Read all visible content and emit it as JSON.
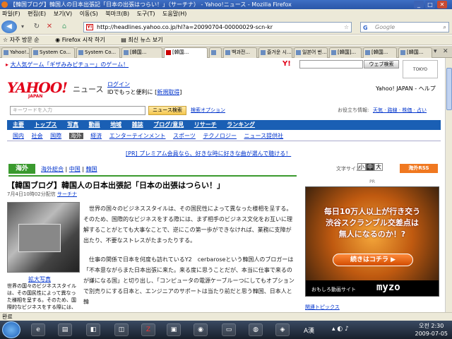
{
  "window": {
    "title": "【韓国ブログ】韓国人の日本出張記「日本の出張はつらい！」（サーチナ） - Yahoo!ニュース - Mozilla Firefox"
  },
  "menu": [
    "파일(F)",
    "편집(E)",
    "보기(V)",
    "이동(S)",
    "북마크(B)",
    "도구(T)",
    "도움말(H)"
  ],
  "nav": {
    "url": "http://headlines.yahoo.co.jp/hl?a=20090704-00000029-scn-kr",
    "search_placeholder": "Google"
  },
  "bookmarks": [
    "자주 방문 순",
    "Firefox 시작 하기",
    "최신 뉴스 보기"
  ],
  "tabs": [
    "Yahoo!...",
    "System Co...",
    "System Co...",
    "[韓国...",
    "[韓国...",
    "[韓国...",
    "[韓国...",
    "[韓国...",
    "백과전...",
    "즐거운 시...",
    "일본어 번...",
    "[韓国]...",
    "[韓国...",
    "[韓国..."
  ],
  "page": {
    "banner_text": "大人気ゲーム「ギザみみピチュー」のゲーム！",
    "logo": "YAHOO!",
    "logo_sub": "JAPAN",
    "news_label": "ニュース",
    "login_text": "ログイン",
    "login_sub": "IDでもっと便利に",
    "register": "新規取得",
    "top_links": "Yahoo! JAPAN - ヘルプ",
    "search_placeholder": "キーワードを入力",
    "search_button": "ニュース検索",
    "search_option": "検索オプション",
    "sites_label": "お役立ち情報:",
    "sites": "天気 · 路線 · 株価 · 占い",
    "global_nav": [
      "トップス",
      "写真",
      "動画",
      "地域",
      "雑誌",
      "ブログ/意見",
      "リサーチ",
      "ランキング"
    ],
    "global_nav_top": "主要",
    "sub_nav": [
      "国際",
      "経済",
      "エンターテインメント",
      "スポーツ",
      "テクノロジー",
      "ニュース提供社"
    ],
    "sub_nav_first": [
      "国内",
      "社会"
    ],
    "sub_nav_active": "海外",
    "promo_text": "[PR] プレミアム会員なら、好きな時に好きな曲が選んで聴ける！",
    "category_label": "海外",
    "breadcrumbs": [
      "海外総合",
      "中国",
      "韓国"
    ],
    "font_size_label": "文字サイズ",
    "font_sizes": [
      "小",
      "中",
      "大"
    ],
    "rss_label": "海外RSS",
    "article_title": "【韓国ブログ】韓国人の日本出張記「日本の出張はつらい！」",
    "article_date": "7月4日10時02分配信",
    "article_source": "サーチナ",
    "photo_link": "拡大写真",
    "photo_caption": "世界の国々のビジネススタイルは、その国民性によって異なった様相を呈する。そのため、国際的なビジネスをする際には、まず相手の",
    "article_body": [
      "世界の国々のビジネススタイルは、その国民性によって異なった様相を呈する。そのため、国際的なビジネスをする際には、まず相手のビジネス文化をお互いに理解することがとても大事なことで、逆にこの第一歩ができなければ、業務に支障が出たり、不要なストレスがたまったりする。",
      "仕事の関係で日本を何度も訪れているY2　cerbaroseという韓国人のブロガーは「不本意ながらまた日本出張に来た。来る度に思うことだが、本当に仕事で来るのが嫌になる国」と切り出し、「コンピュータの電源ケーブルーつにしてもオプションで別売りにする日本と、エンジニアのサポートは当たり前だと思う韓国、日本人と韓"
    ],
    "ad_line1": "毎日10万人以上が行き交う",
    "ad_line2": "渋谷スクランブル交差点は",
    "ad_line3": "無人になるのか！?",
    "ad_button": "続きはコチラ",
    "ad_footer": "おもしろ動画サイト",
    "ad_brand": "myzo",
    "ad_pr": "PR",
    "ad_bottom_link": "関連トピックス"
  },
  "status": "완료",
  "taskbar": {
    "lang": "A漢",
    "time": "오전 2:30",
    "date": "2009-07-05"
  },
  "colors": {
    "yahoo_red": "#e10019",
    "nav_blue": "#1a5fb4",
    "category_green": "#3a9a2e",
    "ad_orange": "#f07820"
  }
}
